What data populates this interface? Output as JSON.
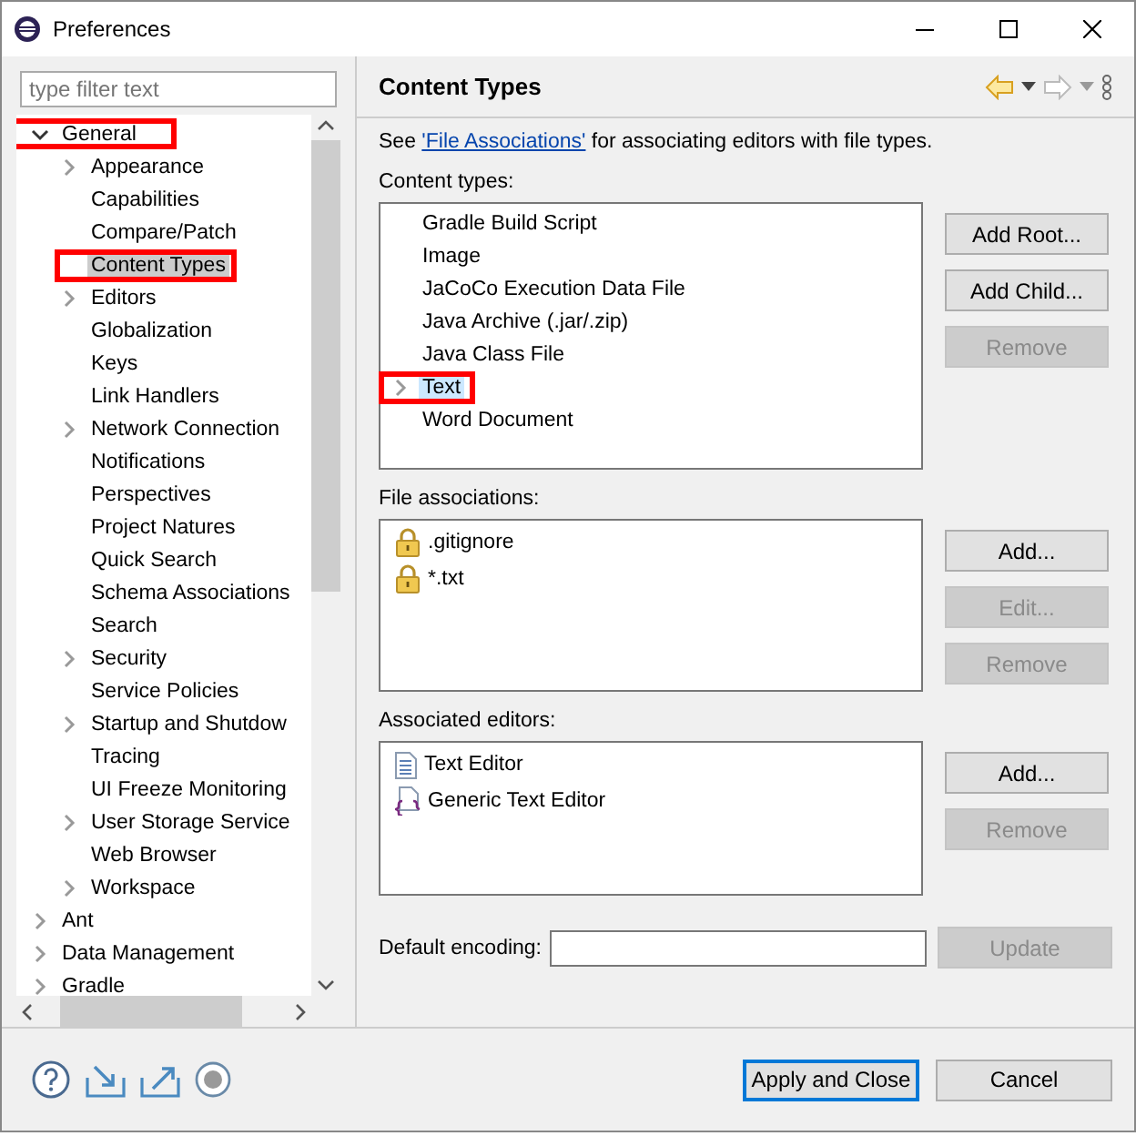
{
  "window": {
    "title": "Preferences"
  },
  "filter": {
    "placeholder": "type filter text"
  },
  "tree": [
    {
      "label": "General",
      "expandable": true,
      "expanded": true,
      "selected": false,
      "annotated": true,
      "children": [
        {
          "label": "Appearance",
          "expandable": true,
          "expanded": false,
          "selected": false
        },
        {
          "label": "Capabilities",
          "expandable": false,
          "selected": false
        },
        {
          "label": "Compare/Patch",
          "expandable": false,
          "selected": false
        },
        {
          "label": "Content Types",
          "expandable": false,
          "selected": true,
          "annotated": true
        },
        {
          "label": "Editors",
          "expandable": true,
          "expanded": false,
          "selected": false
        },
        {
          "label": "Globalization",
          "expandable": false,
          "selected": false
        },
        {
          "label": "Keys",
          "expandable": false,
          "selected": false
        },
        {
          "label": "Link Handlers",
          "expandable": false,
          "selected": false
        },
        {
          "label": "Network Connection",
          "expandable": true,
          "expanded": false,
          "selected": false
        },
        {
          "label": "Notifications",
          "expandable": false,
          "selected": false
        },
        {
          "label": "Perspectives",
          "expandable": false,
          "selected": false
        },
        {
          "label": "Project Natures",
          "expandable": false,
          "selected": false
        },
        {
          "label": "Quick Search",
          "expandable": false,
          "selected": false
        },
        {
          "label": "Schema Associations",
          "expandable": false,
          "selected": false
        },
        {
          "label": "Search",
          "expandable": false,
          "selected": false
        },
        {
          "label": "Security",
          "expandable": true,
          "expanded": false,
          "selected": false
        },
        {
          "label": "Service Policies",
          "expandable": false,
          "selected": false
        },
        {
          "label": "Startup and Shutdow",
          "expandable": true,
          "expanded": false,
          "selected": false
        },
        {
          "label": "Tracing",
          "expandable": false,
          "selected": false
        },
        {
          "label": "UI Freeze Monitoring",
          "expandable": false,
          "selected": false
        },
        {
          "label": "User Storage Service",
          "expandable": true,
          "expanded": false,
          "selected": false
        },
        {
          "label": "Web Browser",
          "expandable": false,
          "selected": false
        },
        {
          "label": "Workspace",
          "expandable": true,
          "expanded": false,
          "selected": false
        }
      ]
    },
    {
      "label": "Ant",
      "expandable": true,
      "expanded": false,
      "selected": false
    },
    {
      "label": "Data Management",
      "expandable": true,
      "expanded": false,
      "selected": false
    },
    {
      "label": "Gradle",
      "expandable": true,
      "expanded": false,
      "selected": false
    }
  ],
  "page": {
    "title": "Content Types",
    "intro": {
      "before": "See ",
      "link": "'File Associations'",
      "after": " for associating editors with file types."
    },
    "content_types": {
      "label": "Content types:",
      "items": [
        {
          "label": "Gradle Build Script",
          "expandable": false,
          "selected": false
        },
        {
          "label": "Image",
          "expandable": false,
          "selected": false
        },
        {
          "label": "JaCoCo Execution Data File",
          "expandable": false,
          "selected": false
        },
        {
          "label": "Java Archive (.jar/.zip)",
          "expandable": false,
          "selected": false
        },
        {
          "label": "Java Class File",
          "expandable": false,
          "selected": false
        },
        {
          "label": "Text",
          "expandable": true,
          "selected": true,
          "annotated": true
        },
        {
          "label": "Word Document",
          "expandable": false,
          "selected": false
        }
      ],
      "buttons": [
        {
          "label": "Add Root...",
          "disabled": false
        },
        {
          "label": "Add Child...",
          "disabled": false
        },
        {
          "label": "Remove",
          "disabled": true
        }
      ]
    },
    "file_associations": {
      "label": "File associations:",
      "items": [
        {
          "label": ".gitignore",
          "kind": "locked"
        },
        {
          "label": "*.txt",
          "kind": "locked"
        }
      ],
      "buttons": [
        {
          "label": "Add...",
          "disabled": false
        },
        {
          "label": "Edit...",
          "disabled": true
        },
        {
          "label": "Remove",
          "disabled": true
        }
      ]
    },
    "associated_editors": {
      "label": "Associated editors:",
      "items": [
        {
          "label": "Text Editor",
          "kind": "text"
        },
        {
          "label": "Generic Text Editor",
          "kind": "generic"
        }
      ],
      "buttons": [
        {
          "label": "Add...",
          "disabled": false
        },
        {
          "label": "Remove",
          "disabled": true
        }
      ]
    },
    "encoding": {
      "label": "Default encoding:",
      "button": {
        "label": "Update",
        "disabled": true
      }
    }
  },
  "footer": {
    "buttons": [
      {
        "label": "Apply and Close",
        "default": true
      },
      {
        "label": "Cancel",
        "default": false
      }
    ]
  }
}
